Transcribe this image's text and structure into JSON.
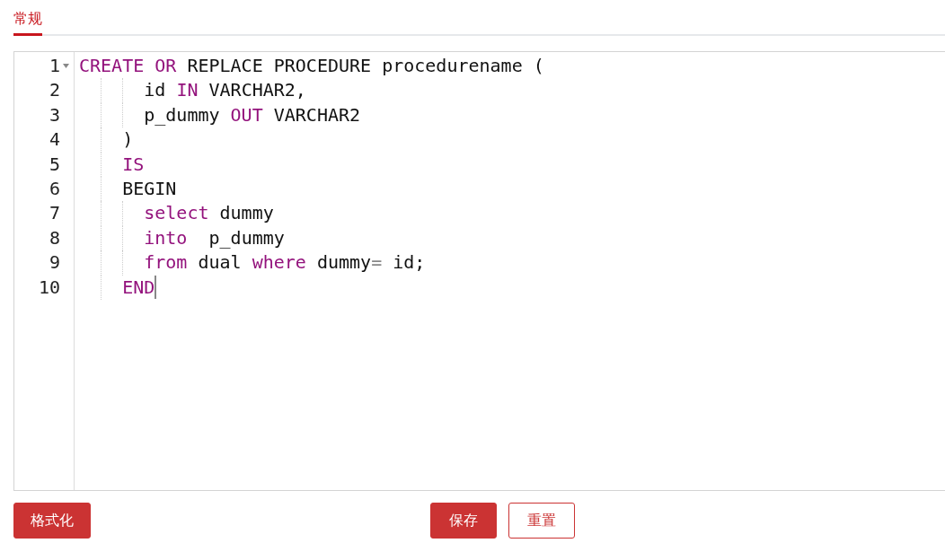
{
  "tabs": [
    {
      "label": "常规",
      "selected": true
    }
  ],
  "editor": {
    "lines": [
      {
        "number": "1",
        "fold": true,
        "tokens": [
          {
            "kind": "keyword",
            "text": "CREATE"
          },
          {
            "kind": "keyword",
            "text": " OR"
          },
          {
            "kind": "plain",
            "text": " REPLACE PROCEDURE procedurename ("
          }
        ]
      },
      {
        "number": "2",
        "fold": false,
        "tokens": [
          {
            "kind": "plain",
            "text": "      id "
          },
          {
            "kind": "keyword",
            "text": "IN"
          },
          {
            "kind": "plain",
            "text": " VARCHAR2,"
          }
        ]
      },
      {
        "number": "3",
        "fold": false,
        "tokens": [
          {
            "kind": "plain",
            "text": "      p_dummy "
          },
          {
            "kind": "keyword",
            "text": "OUT"
          },
          {
            "kind": "plain",
            "text": " VARCHAR2"
          }
        ]
      },
      {
        "number": "4",
        "fold": false,
        "tokens": [
          {
            "kind": "plain",
            "text": "    )"
          }
        ]
      },
      {
        "number": "5",
        "fold": false,
        "tokens": [
          {
            "kind": "keyword",
            "text": "    IS"
          }
        ]
      },
      {
        "number": "6",
        "fold": false,
        "tokens": [
          {
            "kind": "plain",
            "text": "    BEGIN"
          }
        ]
      },
      {
        "number": "7",
        "fold": false,
        "tokens": [
          {
            "kind": "keyword",
            "text": "      select"
          },
          {
            "kind": "plain",
            "text": " dummy"
          }
        ]
      },
      {
        "number": "8",
        "fold": false,
        "tokens": [
          {
            "kind": "keyword",
            "text": "      into"
          },
          {
            "kind": "plain",
            "text": "  p_dummy"
          }
        ]
      },
      {
        "number": "9",
        "fold": false,
        "tokens": [
          {
            "kind": "keyword",
            "text": "      from"
          },
          {
            "kind": "plain",
            "text": " dual "
          },
          {
            "kind": "keyword",
            "text": "where"
          },
          {
            "kind": "plain",
            "text": " dummy"
          },
          {
            "kind": "operator",
            "text": "="
          },
          {
            "kind": "plain",
            "text": " id;"
          }
        ]
      },
      {
        "number": "10",
        "fold": false,
        "tokens": [
          {
            "kind": "keyword",
            "text": "    END"
          }
        ]
      }
    ]
  },
  "buttons": [
    {
      "label": "格式化",
      "kind": "primary"
    },
    {
      "label": "保存",
      "kind": "primary"
    },
    {
      "label": "重置",
      "kind": "outline"
    }
  ]
}
